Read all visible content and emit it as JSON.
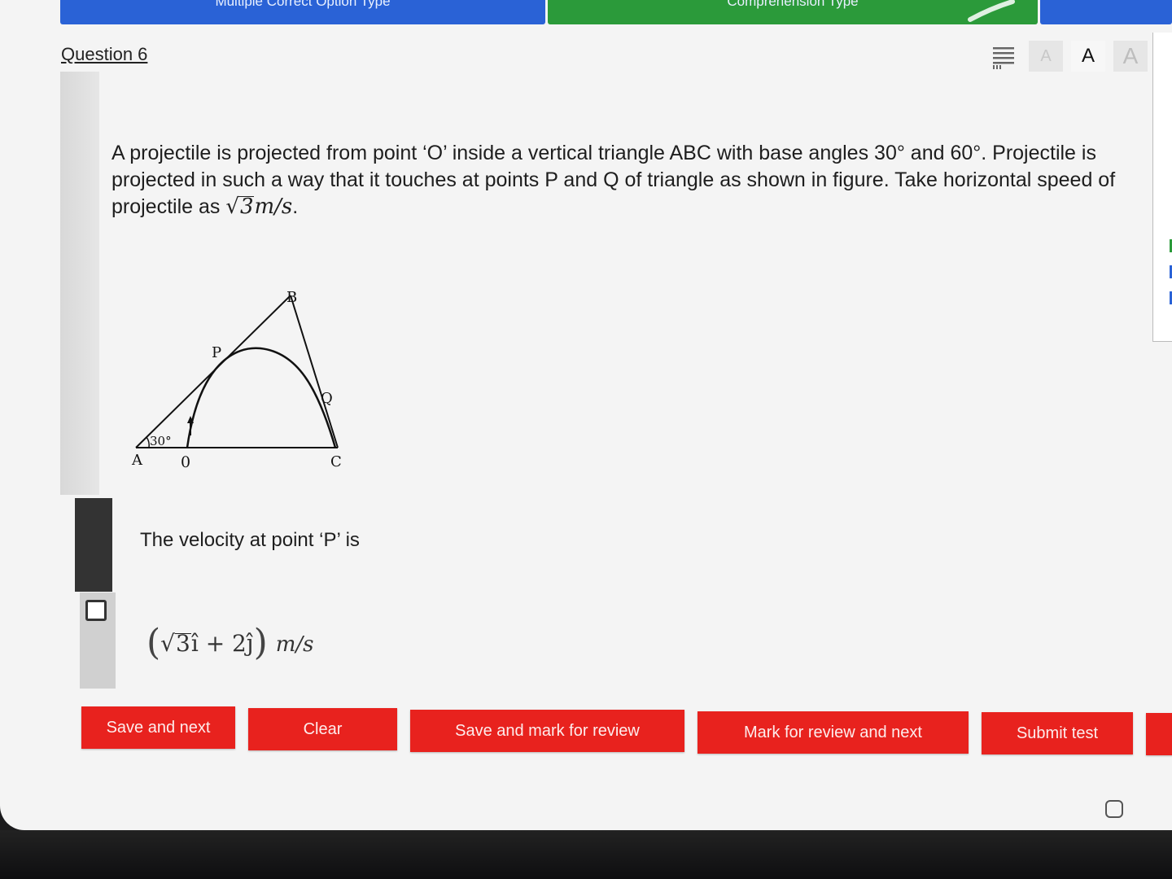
{
  "tabs": [
    {
      "label": "Multiple Correct Option Type"
    },
    {
      "label": "Comprehension Type"
    }
  ],
  "question": {
    "title": "Question 6",
    "text_main": "A projectile is projected from point ‘O’ inside a vertical triangle ABC with base angles 30° and 60°. Projectile is projected in such a way that it touches at points P and Q of triangle as shown in figure. Take horizontal speed of projectile as ",
    "speed_radicand": "3",
    "speed_unit": "m/s",
    "speed_end": ".",
    "sub_question": "The velocity at point ‘P’ is"
  },
  "font_size_controls": {
    "small": "A",
    "medium": "A",
    "large": "A"
  },
  "figure": {
    "labels": {
      "A": "A",
      "B": "B",
      "C": "C",
      "O": "0",
      "P": "P",
      "Q": "Q",
      "angle": "30°"
    }
  },
  "option": {
    "radicand": "3",
    "i_term": "î + 2ĵ",
    "unit": "m/s"
  },
  "buttons": {
    "save_next": "Save and next",
    "clear": "Clear",
    "save_mark": "Save and mark for review",
    "mark_next": "Mark for review and next",
    "submit": "Submit test"
  },
  "colors": {
    "tab_blue": "#2a62d6",
    "tab_green": "#2b9a3a",
    "button_red": "#e8221e"
  }
}
